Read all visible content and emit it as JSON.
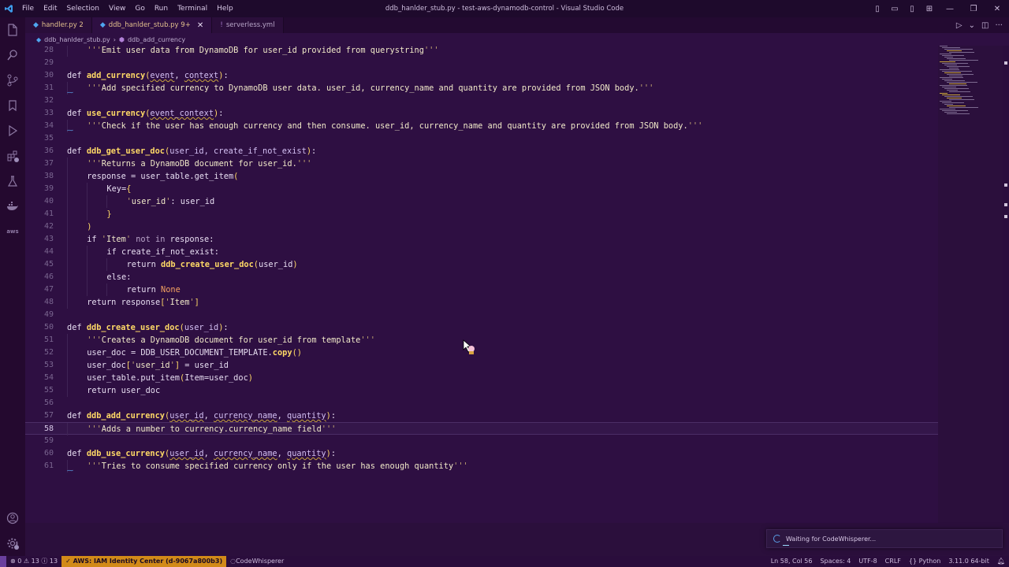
{
  "titlebar": {
    "menu": [
      "File",
      "Edit",
      "Selection",
      "View",
      "Go",
      "Run",
      "Terminal",
      "Help"
    ],
    "window_title": "ddb_hanlder_stub.py - test-aws-dynamodb-control - Visual Studio Code"
  },
  "tabs": [
    {
      "label": "handler.py 2",
      "type": "py",
      "active": false
    },
    {
      "label": "ddb_hanlder_stub.py 9+",
      "type": "py",
      "active": true
    },
    {
      "label": "serverless.yml",
      "type": "yml",
      "active": false
    }
  ],
  "breadcrumb": {
    "file": "ddb_hanlder_stub.py",
    "symbol": "ddb_add_currency"
  },
  "editor": {
    "current_line": 58,
    "lines": [
      {
        "n": "28",
        "indent": 1,
        "html": "<span class='strq'>'''</span><span class='str'>Emit user data from DynamoDB for user_id provided from querystring</span><span class='strq'>'''</span>"
      },
      {
        "n": "29",
        "indent": 0,
        "html": ""
      },
      {
        "n": "30",
        "indent": 0,
        "html": "<span class='kw'>def </span><span class='fn'>add_currency</span><span class='punc'>(</span><span class='param'>event</span>, <span class='param'>context</span><span class='punc'>)</span>:"
      },
      {
        "n": "31",
        "indent": 1,
        "hint": true,
        "html": "<span class='strq'>'''</span><span class='str'>Add specified currency to DynamoDB user data. user_id, currency_name and quantity are provided from JSON body.</span><span class='strq'>'''</span>"
      },
      {
        "n": "32",
        "indent": 0,
        "html": ""
      },
      {
        "n": "33",
        "indent": 0,
        "html": "<span class='kw'>def </span><span class='fn'>use_currency</span><span class='punc'>(</span><span class='param'>event_context</span><span class='punc'>)</span>:"
      },
      {
        "n": "34",
        "indent": 1,
        "hint": true,
        "html": "<span class='strq'>'''</span><span class='str'>Check if the user has enough currency and then consume. user_id, currency_name and quantity are provided from JSON body.</span><span class='strq'>'''</span>"
      },
      {
        "n": "35",
        "indent": 0,
        "html": ""
      },
      {
        "n": "36",
        "indent": 0,
        "html": "<span class='kw'>def </span><span class='fn'>ddb_get_user_doc</span><span class='punc'>(</span><span class='paramplain'>user_id, create_if_not_exist</span><span class='punc'>)</span>:"
      },
      {
        "n": "37",
        "indent": 1,
        "html": "<span class='strq'>'''</span><span class='str'>Returns a DynamoDB document for user_id.</span><span class='strq'>'''</span>"
      },
      {
        "n": "38",
        "indent": 1,
        "html": "response = user_table.get_item<span class='punc'>(</span>"
      },
      {
        "n": "39",
        "indent": 2,
        "html": "Key=<span class='punc'>{</span>"
      },
      {
        "n": "40",
        "indent": 3,
        "html": "<span class='strq'>'</span><span class='str'>user_id</span><span class='strq'>'</span>: user_id"
      },
      {
        "n": "41",
        "indent": 2,
        "html": "<span class='punc'>}</span>"
      },
      {
        "n": "42",
        "indent": 1,
        "html": "<span class='punc'>)</span>"
      },
      {
        "n": "43",
        "indent": 1,
        "html": "if <span class='strq'>'</span><span class='str'>Item</span><span class='strq'>'</span> <span class='kw2'>not in</span> response:"
      },
      {
        "n": "44",
        "indent": 2,
        "html": "if create_if_not_exist:"
      },
      {
        "n": "45",
        "indent": 3,
        "html": "return <span class='fn'>ddb_create_user_doc</span><span class='punc'>(</span>user_id<span class='punc'>)</span>"
      },
      {
        "n": "46",
        "indent": 2,
        "html": "else:"
      },
      {
        "n": "47",
        "indent": 3,
        "html": "return <span class='const'>None</span>"
      },
      {
        "n": "48",
        "indent": 1,
        "html": "return response<span class='punc'>[</span><span class='strq'>'</span><span class='str'>Item</span><span class='strq'>'</span><span class='punc'>]</span>"
      },
      {
        "n": "49",
        "indent": 0,
        "html": ""
      },
      {
        "n": "50",
        "indent": 0,
        "html": "<span class='kw'>def </span><span class='fn'>ddb_create_user_doc</span><span class='punc'>(</span><span class='paramplain'>user_id</span><span class='punc'>)</span>:"
      },
      {
        "n": "51",
        "indent": 1,
        "html": "<span class='strq'>'''</span><span class='str'>Creates a DynamoDB document for user_id from template</span><span class='strq'>'''</span>"
      },
      {
        "n": "52",
        "indent": 1,
        "html": "user_doc = DDB_USER_DOCUMENT_TEMPLATE.<span class='fn'>copy</span><span class='punc'>()</span>"
      },
      {
        "n": "53",
        "indent": 1,
        "html": "user_doc<span class='punc'>[</span><span class='strq'>'</span><span class='str'>user_id</span><span class='strq'>'</span><span class='punc'>]</span> = user_id"
      },
      {
        "n": "54",
        "indent": 1,
        "html": "user_table.put_item<span class='punc'>(</span>Item=user_doc<span class='punc'>)</span>"
      },
      {
        "n": "55",
        "indent": 1,
        "html": "return user_doc"
      },
      {
        "n": "56",
        "indent": 0,
        "html": ""
      },
      {
        "n": "57",
        "indent": 0,
        "html": "<span class='kw'>def </span><span class='fn'>ddb_add_currency</span><span class='punc'>(</span><span class='param'>user_id</span>, <span class='param'>currency_name</span>, <span class='param'>quantity</span><span class='punc'>)</span>:"
      },
      {
        "n": "58",
        "indent": 1,
        "html": "<span class='strq'>'''</span><span class='str'>Adds a number to currency.currency_name field</span><span class='strq'>'''</span>"
      },
      {
        "n": "59",
        "indent": 0,
        "html": ""
      },
      {
        "n": "60",
        "indent": 0,
        "html": "<span class='kw'>def </span><span class='fn'>ddb_use_currency</span><span class='punc'>(</span><span class='param'>user_id</span>, <span class='param'>currency_name</span>, <span class='param'>quantity</span><span class='punc'>)</span>:"
      },
      {
        "n": "61",
        "indent": 1,
        "hint": true,
        "html": "<span class='strq'>'''</span><span class='str'>Tries to consume specified currency only if the user has enough quantity</span><span class='strq'>'''</span>"
      }
    ]
  },
  "statusbar": {
    "errors": "0",
    "warnings": "13",
    "info": "13",
    "aws": "AWS: IAM Identity Center (d-9067a800b3)",
    "codewhisperer": "CodeWhisperer",
    "position": "Ln 58, Col 56",
    "spaces": "Spaces: 4",
    "encoding": "UTF-8",
    "eol": "CRLF",
    "language": "Python",
    "interpreter": "3.11.0 64-bit"
  },
  "notification": {
    "text": "Waiting for CodeWhisperer..."
  },
  "colors": {
    "accent": "#d28a18",
    "background": "#2e0f42",
    "function": "#ffd966"
  }
}
